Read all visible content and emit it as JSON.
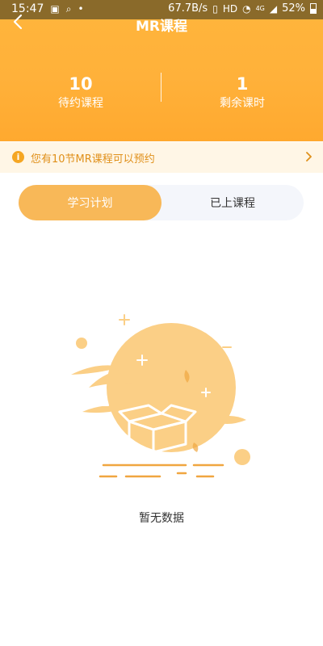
{
  "status_bar": {
    "time": "15:47",
    "speed": "67.7B/s",
    "network": "4G",
    "battery": "52%",
    "icons": [
      "app-notification-icon",
      "search-icon",
      "dot-icon",
      "vibrate-icon",
      "hd-icon",
      "wifi-icon",
      "signal-icon",
      "battery-icon"
    ]
  },
  "nav": {
    "title": "MR课程",
    "back_icon": "chevron-left-icon"
  },
  "stats": [
    {
      "value": "10",
      "label": "待约课程"
    },
    {
      "value": "1",
      "label": "剩余课时"
    }
  ],
  "notice": {
    "text": "您有10节MR课程可以预约",
    "icon": "info-icon",
    "arrow_icon": "chevron-right-icon"
  },
  "tabs": [
    {
      "label": "学习计划",
      "active": true
    },
    {
      "label": "已上课程",
      "active": false
    }
  ],
  "empty": {
    "text": "暂无数据",
    "illustration": "empty-box-illustration"
  },
  "colors": {
    "header": "#ffb13a",
    "accent": "#f8b858",
    "notice_bg": "#fff6e6",
    "notice_text": "#e0901a",
    "tab_bg": "#f4f6fb"
  }
}
